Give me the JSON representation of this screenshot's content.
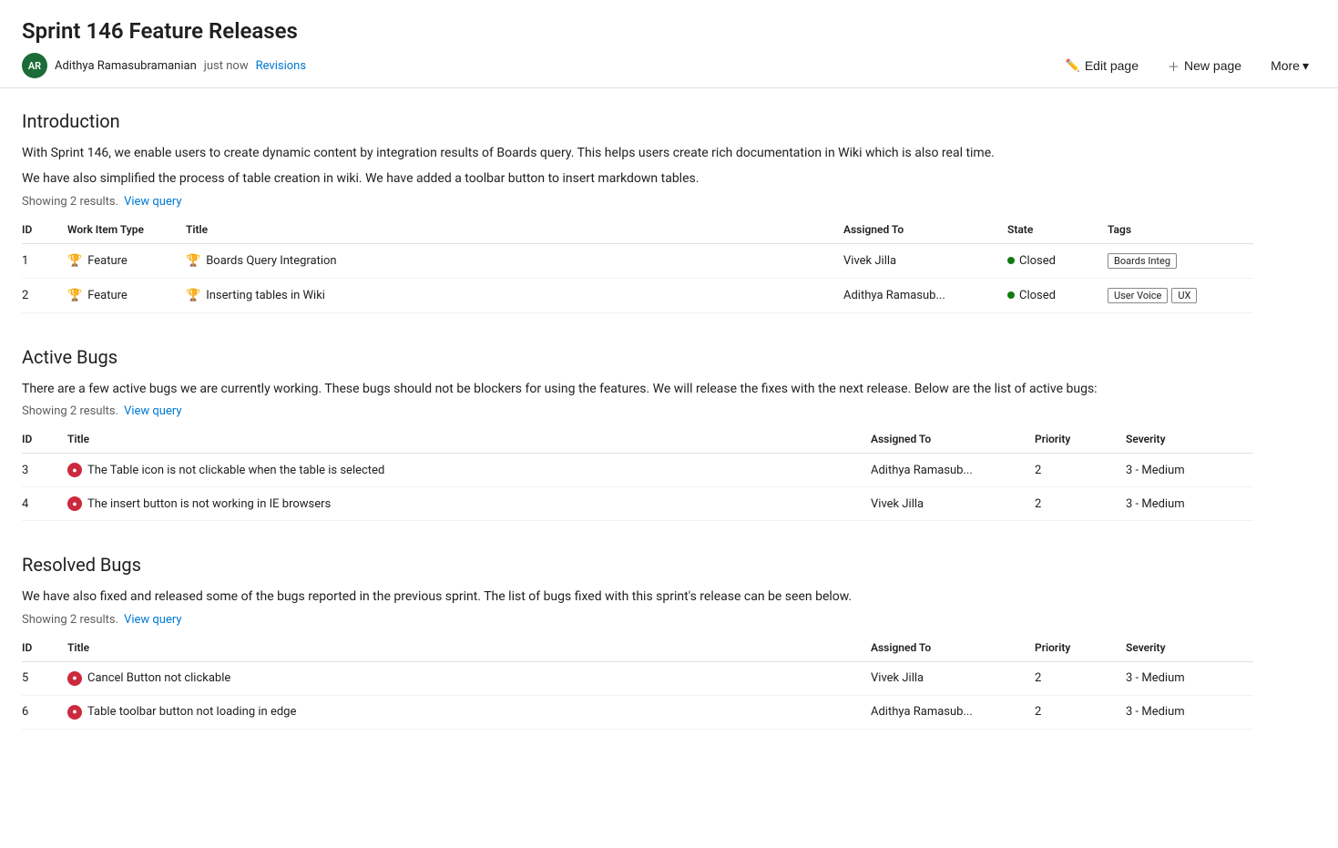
{
  "page": {
    "title": "Sprint 146 Feature Releases"
  },
  "meta": {
    "avatar_initials": "AR",
    "author": "Adithya Ramasubramanian",
    "timestamp": "just now",
    "revisions_label": "Revisions"
  },
  "toolbar": {
    "edit_label": "Edit page",
    "new_page_label": "New page",
    "more_label": "More"
  },
  "introduction": {
    "heading": "Introduction",
    "paragraphs": [
      "With Sprint 146, we enable users to create dynamic content by integration results of Boards query. This helps users create rich documentation in Wiki which is also real time.",
      "We have also simplified the process of table creation in wiki. We have added a toolbar button to insert markdown tables."
    ],
    "results_text": "Showing 2 results.",
    "view_query_label": "View query",
    "table": {
      "columns": [
        "ID",
        "Work Item Type",
        "Title",
        "Assigned To",
        "State",
        "Tags"
      ],
      "rows": [
        {
          "id": "1",
          "type": "Feature",
          "type_icon": "trophy",
          "title": "Boards Query Integration",
          "assigned_to": "Vivek Jilla",
          "state": "Closed",
          "state_type": "closed",
          "tags": [
            "Boards Integ"
          ]
        },
        {
          "id": "2",
          "type": "Feature",
          "type_icon": "trophy",
          "title": "Inserting tables in Wiki",
          "assigned_to": "Adithya Ramasub...",
          "state": "Closed",
          "state_type": "closed",
          "tags": [
            "User Voice",
            "UX"
          ]
        }
      ]
    }
  },
  "active_bugs": {
    "heading": "Active Bugs",
    "paragraph": "There are a few active bugs we are currently working. These bugs should not be blockers for using the features. We will release the fixes with the next release. Below are the list of active bugs:",
    "results_text": "Showing 2 results.",
    "view_query_label": "View query",
    "table": {
      "columns": [
        "ID",
        "Title",
        "Assigned To",
        "Priority",
        "Severity"
      ],
      "rows": [
        {
          "id": "3",
          "type_icon": "bug",
          "title": "The Table icon is not clickable when the table is selected",
          "assigned_to": "Adithya Ramasub...",
          "priority": "2",
          "severity": "3 - Medium"
        },
        {
          "id": "4",
          "type_icon": "bug",
          "title": "The insert button is not working in IE browsers",
          "assigned_to": "Vivek Jilla",
          "priority": "2",
          "severity": "3 - Medium"
        }
      ]
    }
  },
  "resolved_bugs": {
    "heading": "Resolved Bugs",
    "paragraph": "We have also fixed and released some of the bugs reported in the previous sprint. The list of bugs fixed with this sprint's release can be seen below.",
    "results_text": "Showing 2 results.",
    "view_query_label": "View query",
    "table": {
      "columns": [
        "ID",
        "Title",
        "Assigned To",
        "Priority",
        "Severity"
      ],
      "rows": [
        {
          "id": "5",
          "type_icon": "bug",
          "title": "Cancel Button not clickable",
          "assigned_to": "Vivek Jilla",
          "priority": "2",
          "severity": "3 - Medium"
        },
        {
          "id": "6",
          "type_icon": "bug",
          "title": "Table toolbar button not loading in edge",
          "assigned_to": "Adithya Ramasub...",
          "priority": "2",
          "severity": "3 - Medium"
        }
      ]
    }
  }
}
